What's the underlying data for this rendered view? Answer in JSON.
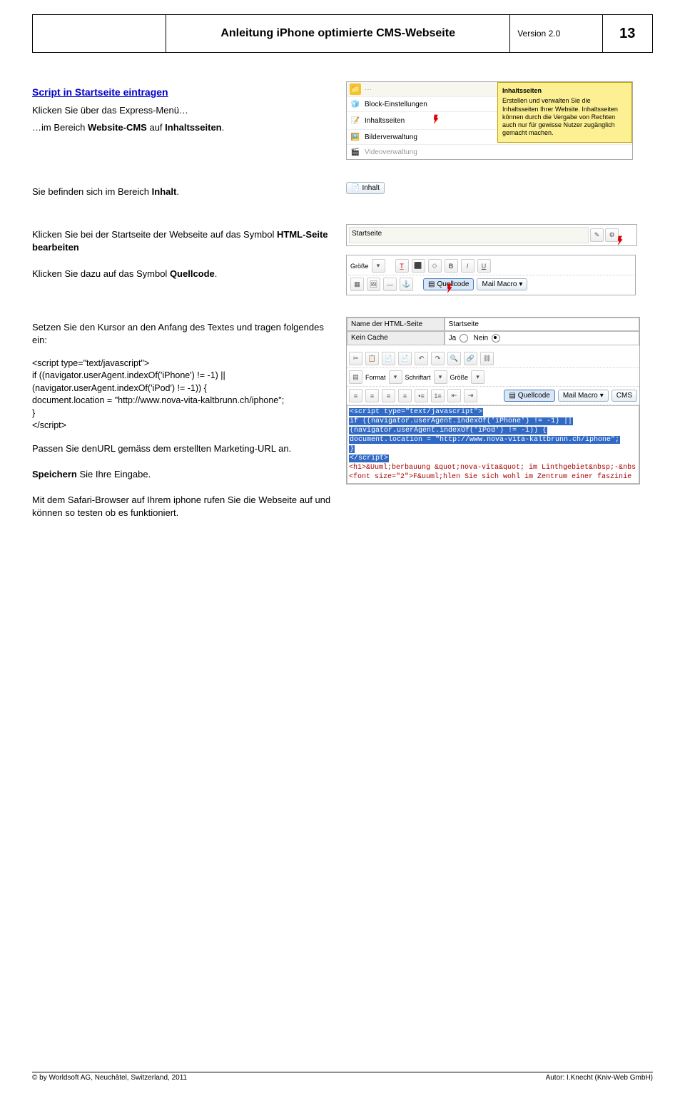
{
  "header": {
    "title": "Anleitung iPhone optimierte CMS-Webseite",
    "version": "Version 2.0",
    "page": "13"
  },
  "section1": {
    "heading": "Script in Startseite eintragen",
    "p1a": "Klicken Sie über das Express-Menü…",
    "p1b_pre": "…im Bereich ",
    "p1b_bold1": "Website-CMS",
    "p1b_mid": " auf ",
    "p1b_bold2": "Inhaltsseiten",
    "p1b_post": "."
  },
  "shot1": {
    "items": [
      "Block-Einstellungen",
      "Inhaltsseiten",
      "Bilderverwaltung",
      "Videoverwaltung"
    ],
    "tip_title": "Inhaltsseiten",
    "tip_body": "Erstellen und verwalten Sie die Inhaltsseiten Ihrer Website. Inhaltsseiten können durch die Vergabe von Rechten auch nur für gewisse Nutzer zugänglich gemacht machen."
  },
  "section2": {
    "p_pre": "Sie befinden sich im Bereich ",
    "p_bold": "Inhalt",
    "p_post": "."
  },
  "shot2": {
    "tab": "Inhalt"
  },
  "section3": {
    "p1_pre": "Klicken Sie bei der Startseite der Webseite auf das Symbol ",
    "p1_bold": "HTML-Seite bearbeiten",
    "p2_pre": "Klicken Sie dazu auf das Symbol ",
    "p2_bold": "Quellcode",
    "p2_post": "."
  },
  "shot3": {
    "row_name": "Startseite"
  },
  "shot4": {
    "groesse": "Größe",
    "quellcode": "Quellcode",
    "mailmacro": "Mail Macro"
  },
  "section4": {
    "p1": "Setzen Sie den Kursor an den Anfang des Textes und tragen folgendes ein:",
    "code": [
      "<script type=\"text/javascript\">",
      "if ((navigator.userAgent.indexOf('iPhone') != -1) ||",
      "(navigator.userAgent.indexOf('iPod') != -1)) {",
      "document.location = \"http://www.nova-vita-kaltbrunn.ch/iphone\";",
      "}",
      "</scr"
    ],
    "code_close": "ipt>",
    "p2": "Passen Sie denURL gemäss dem erstellten Marketing-URL an.",
    "p3_bold": "Speichern",
    "p3_post": " Sie Ihre Eingabe.",
    "p4": "Mit dem Safari-Browser auf Ihrem iphone rufen Sie die Webseite auf und können so testen ob es funktioniert."
  },
  "shot5": {
    "h_name": "Name der HTML-Seite",
    "h_val": "Startseite",
    "h_cache": "Kein Cache",
    "ja": "Ja",
    "nein": "Nein",
    "format": "Format",
    "schriftart": "Schriftart",
    "groesse": "Größe",
    "quellcode": "Quellcode",
    "mailmacro": "Mail Macro",
    "cms": "CMS",
    "code1": "<script type=\"text/javascript\">",
    "code2": "if ((navigator.userAgent.indexOf('iPhone') != -1) ||",
    "code3": "(navigator.userAgent.indexOf('iPod') != -1)) {",
    "code4": "document.location = \"http://www.nova-vita-kaltbrunn.ch/iphone\";",
    "code5": "}",
    "code6": "</script>",
    "html1": "<h1>&Uuml;berbauung &quot;nova-vita&quot; im Linthgebiet&nbsp;-&nbs",
    "html2": "<font size=\"2\">F&uuml;hlen Sie sich wohl im Zentrum einer faszinie"
  },
  "footer": {
    "left": "© by Worldsoft AG, Neuchâtel, Switzerland, 2011",
    "right": "Autor: I.Knecht (Kniv-Web GmbH)"
  }
}
